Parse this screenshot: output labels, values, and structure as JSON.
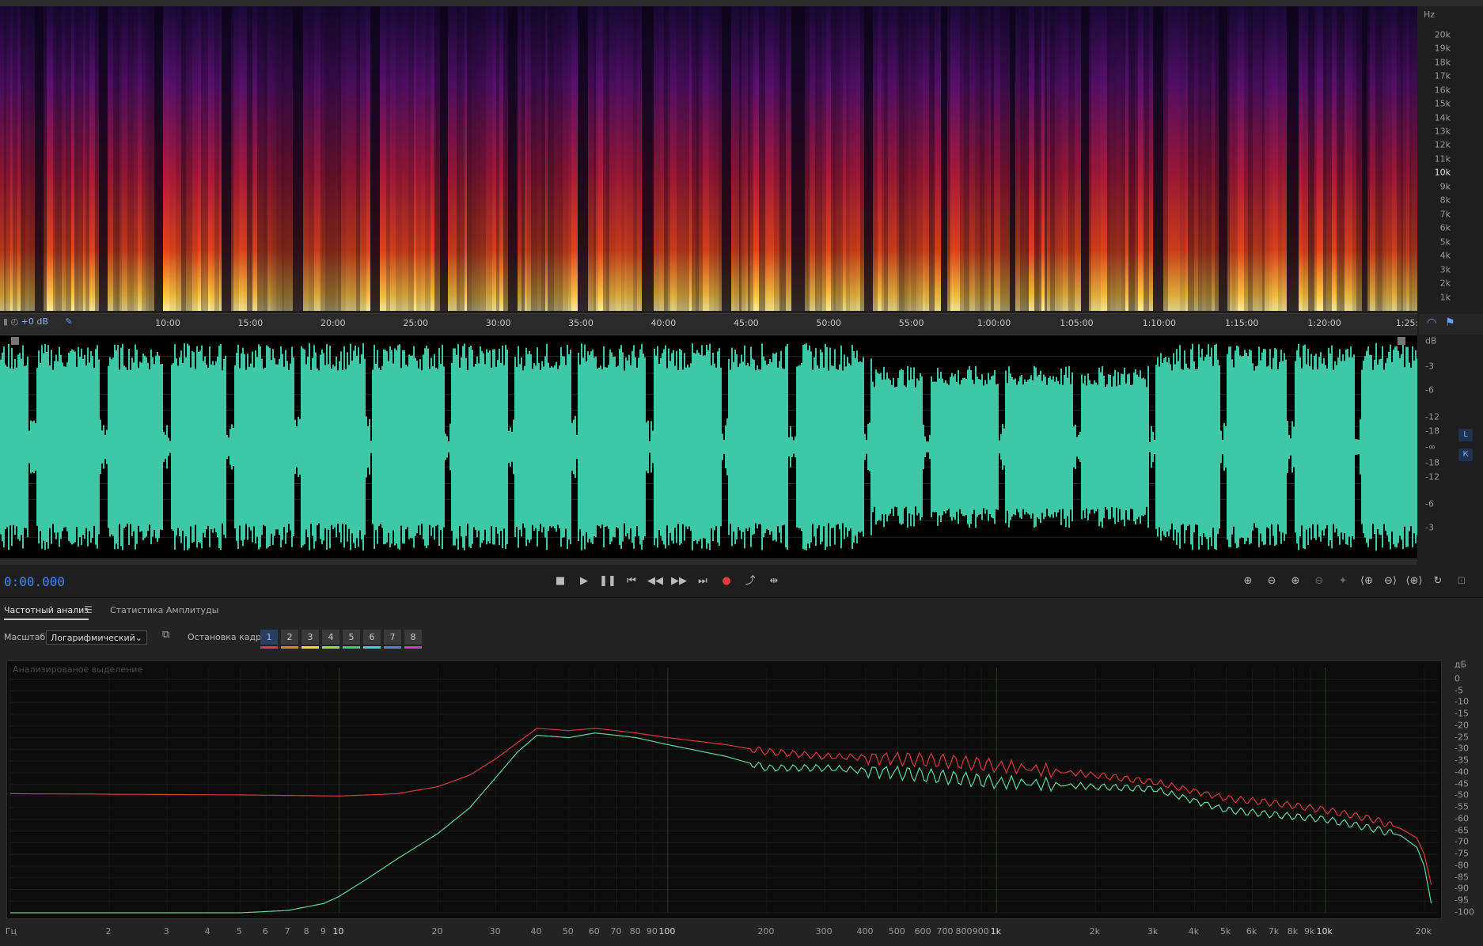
{
  "spectrogram": {
    "unit": "Hz",
    "ticks": [
      {
        "label": "20k",
        "v": 20000
      },
      {
        "label": "19k",
        "v": 19000
      },
      {
        "label": "18k",
        "v": 18000
      },
      {
        "label": "17k",
        "v": 17000
      },
      {
        "label": "16k",
        "v": 16000
      },
      {
        "label": "15k",
        "v": 15000
      },
      {
        "label": "14k",
        "v": 14000
      },
      {
        "label": "13k",
        "v": 13000
      },
      {
        "label": "12k",
        "v": 12000
      },
      {
        "label": "11k",
        "v": 11000
      },
      {
        "label": "10k",
        "v": 10000,
        "bold": true
      },
      {
        "label": "9k",
        "v": 9000
      },
      {
        "label": "8k",
        "v": 8000
      },
      {
        "label": "7k",
        "v": 7000
      },
      {
        "label": "6k",
        "v": 6000
      },
      {
        "label": "5k",
        "v": 5000
      },
      {
        "label": "4k",
        "v": 4000
      },
      {
        "label": "3k",
        "v": 3000
      },
      {
        "label": "2k",
        "v": 2000
      },
      {
        "label": "1k",
        "v": 1000
      }
    ]
  },
  "timeline": {
    "gain_label": "+0 dB",
    "labels": [
      "10:00",
      "15:00",
      "20:00",
      "25:00",
      "30:00",
      "35:00",
      "40:00",
      "45:00",
      "50:00",
      "55:00",
      "1:00:00",
      "1:05:00",
      "1:10:00",
      "1:15:00",
      "1:20:00",
      "1:25:"
    ],
    "minutes": [
      10,
      15,
      20,
      25,
      30,
      35,
      40,
      45,
      50,
      55,
      60,
      65,
      70,
      75,
      80,
      85
    ]
  },
  "waveform": {
    "unit": "dB",
    "ticks": [
      "-3",
      "-6",
      "-12",
      "-18",
      "-∞",
      "-18",
      "-12",
      "-6",
      "-3"
    ],
    "channel_left": "L",
    "channel_right": "К",
    "color": "#3ec8a6"
  },
  "transport": {
    "time": "0:00.000"
  },
  "panel": {
    "tab_frequency": "Частотный анализ",
    "tab_amplitude": "Статистика Амплитуды",
    "scale_label": "Масштаб:",
    "scale_value": "Логарифмический",
    "freeze_label": "Остановка кадра:",
    "frames": [
      "1",
      "2",
      "3",
      "4",
      "5",
      "6",
      "7",
      "8"
    ],
    "frame_colors": [
      "#e23b3b",
      "#f07f1c",
      "#f2e224",
      "#9be23b",
      "#3bd65a",
      "#3bd6d0",
      "#3b8ef0",
      "#d23bd6"
    ],
    "note": "Анализированое выделение"
  },
  "chart_data": {
    "type": "line",
    "xlabel": "Гц",
    "ylabel": "дБ",
    "x_scale": "log",
    "xlim": [
      1,
      22000
    ],
    "ylim": [
      -100,
      5
    ],
    "x_ticks": [
      {
        "label": "Гц",
        "v": 1
      },
      {
        "label": "2",
        "v": 2
      },
      {
        "label": "3",
        "v": 3
      },
      {
        "label": "4",
        "v": 4
      },
      {
        "label": "5",
        "v": 5
      },
      {
        "label": "6",
        "v": 6
      },
      {
        "label": "7",
        "v": 7
      },
      {
        "label": "8",
        "v": 8
      },
      {
        "label": "9",
        "v": 9
      },
      {
        "label": "10",
        "v": 10,
        "bold": true
      },
      {
        "label": "20",
        "v": 20
      },
      {
        "label": "30",
        "v": 30
      },
      {
        "label": "40",
        "v": 40
      },
      {
        "label": "50",
        "v": 50
      },
      {
        "label": "60",
        "v": 60
      },
      {
        "label": "70",
        "v": 70
      },
      {
        "label": "80",
        "v": 80
      },
      {
        "label": "90",
        "v": 90
      },
      {
        "label": "100",
        "v": 100,
        "bold": true
      },
      {
        "label": "200",
        "v": 200
      },
      {
        "label": "300",
        "v": 300
      },
      {
        "label": "400",
        "v": 400
      },
      {
        "label": "500",
        "v": 500
      },
      {
        "label": "600",
        "v": 600
      },
      {
        "label": "700",
        "v": 700
      },
      {
        "label": "800",
        "v": 800
      },
      {
        "label": "900",
        "v": 900
      },
      {
        "label": "1k",
        "v": 1000,
        "bold": true
      },
      {
        "label": "2k",
        "v": 2000
      },
      {
        "label": "3k",
        "v": 3000
      },
      {
        "label": "4k",
        "v": 4000
      },
      {
        "label": "5k",
        "v": 5000
      },
      {
        "label": "6k",
        "v": 6000
      },
      {
        "label": "7k",
        "v": 7000
      },
      {
        "label": "8k",
        "v": 8000
      },
      {
        "label": "9k",
        "v": 9000
      },
      {
        "label": "10k",
        "v": 10000,
        "bold": true
      },
      {
        "label": "20k",
        "v": 20000
      }
    ],
    "y_ticks": [
      0,
      -5,
      -10,
      -15,
      -20,
      -25,
      -30,
      -35,
      -40,
      -45,
      -50,
      -55,
      -60,
      -65,
      -70,
      -75,
      -80,
      -85,
      -90,
      -95,
      -100
    ],
    "series": [
      {
        "color": "#d83a3a",
        "x": [
          1,
          5,
          10,
          15,
          20,
          25,
          30,
          35,
          40,
          50,
          60,
          70,
          80,
          100,
          150,
          200,
          300,
          500,
          700,
          1000,
          2000,
          3000,
          5000,
          7000,
          10000,
          14000,
          17000,
          19000,
          20000,
          21000
        ],
        "y": [
          -49,
          -49.5,
          -50,
          -49,
          -46,
          -41,
          -34,
          -27,
          -21,
          -22,
          -21,
          -22,
          -23,
          -25,
          -28,
          -31,
          -33,
          -34,
          -35,
          -37,
          -41,
          -44,
          -51,
          -53,
          -56,
          -60,
          -64,
          -68,
          -75,
          -88
        ]
      },
      {
        "color": "#5fd6a2",
        "x": [
          1,
          5,
          7,
          9,
          10,
          12,
          15,
          20,
          25,
          30,
          35,
          40,
          50,
          60,
          70,
          80,
          100,
          150,
          200,
          300,
          500,
          700,
          1000,
          2000,
          3000,
          5000,
          7000,
          10000,
          14000,
          17000,
          19000,
          20000,
          21000
        ],
        "y": [
          -100,
          -100,
          -99,
          -96,
          -93,
          -86,
          -77,
          -66,
          -55,
          -42,
          -31,
          -24,
          -25,
          -23,
          -24,
          -25,
          -28,
          -33,
          -38,
          -38,
          -40,
          -42,
          -44,
          -46,
          -47,
          -56,
          -58,
          -60,
          -64,
          -67,
          -72,
          -80,
          -96
        ]
      }
    ]
  }
}
